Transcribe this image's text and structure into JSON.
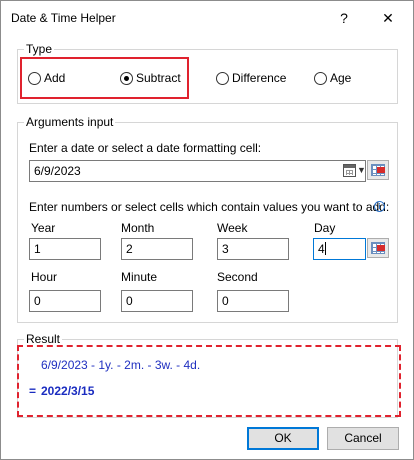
{
  "window": {
    "title": "Date & Time Helper",
    "help_glyph": "?",
    "close_glyph": "✕"
  },
  "type_group": {
    "legend": "Type",
    "options": [
      {
        "label": "Add",
        "checked": false
      },
      {
        "label": "Subtract",
        "checked": true
      },
      {
        "label": "Difference",
        "checked": false
      },
      {
        "label": "Age",
        "checked": false
      }
    ]
  },
  "arguments_group": {
    "legend": "Arguments input",
    "date_prompt": "Enter a date or select a date formatting cell:",
    "date_value": "6/9/2023",
    "numbers_prompt": "Enter numbers or select cells which contain values you want to add:",
    "fields": [
      {
        "label": "Year",
        "value": "1"
      },
      {
        "label": "Month",
        "value": "2"
      },
      {
        "label": "Week",
        "value": "3"
      },
      {
        "label": "Day",
        "value": "4"
      },
      {
        "label": "Hour",
        "value": "0"
      },
      {
        "label": "Minute",
        "value": "0"
      },
      {
        "label": "Second",
        "value": "0"
      }
    ]
  },
  "result_group": {
    "legend": "Result",
    "expression": "6/9/2023 - 1y. - 2m. - 3w. - 4d.",
    "equals": "=",
    "answer": "2022/3/15"
  },
  "buttons": {
    "ok": "OK",
    "cancel": "Cancel"
  },
  "icons": {
    "calendar": "calendar-icon",
    "cell_picker": "range-select-icon",
    "info": "info-icon"
  },
  "colors": {
    "highlight": "#e0222e",
    "result_text": "#2030c0",
    "accent": "#0078d7"
  }
}
